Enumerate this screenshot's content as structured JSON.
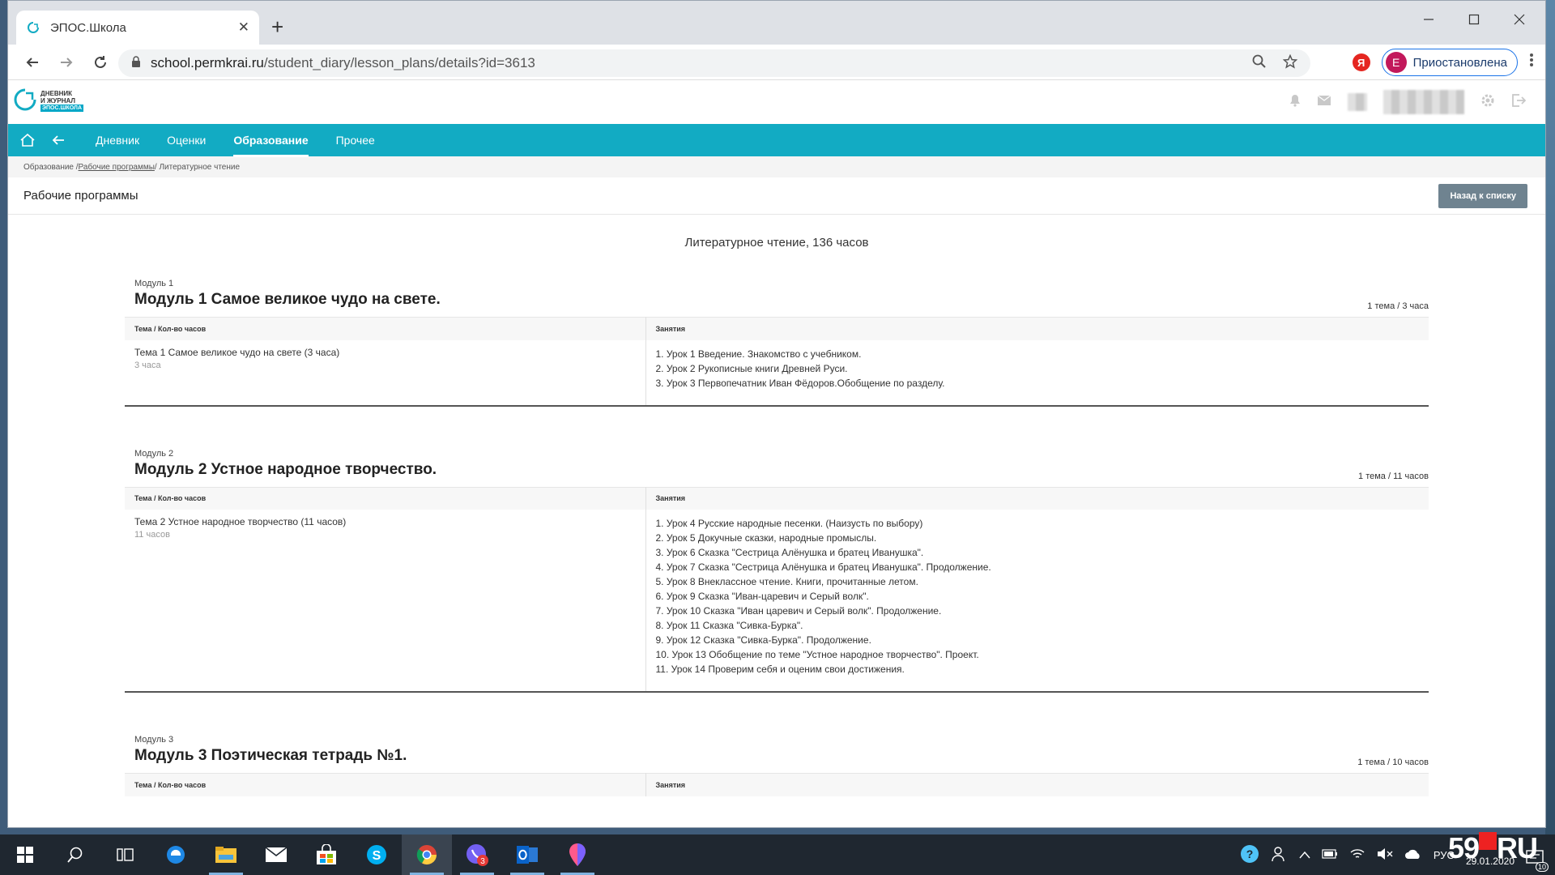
{
  "browser": {
    "tab_title": "ЭПОС.Школа",
    "tab_close": "✕",
    "new_tab": "+",
    "url_host": "school.permkrai.ru",
    "url_path": "/student_diary/lesson_plans/details?id=3613",
    "yandex_label": "Я",
    "profile_initial": "E",
    "profile_label": "Приостановлена"
  },
  "site": {
    "logo_line1": "ДНЕВНИК",
    "logo_line2": "И ЖУРНАЛ",
    "logo_line3": "ЭПОС.ШКОЛА"
  },
  "nav": {
    "items": [
      {
        "label": "Дневник"
      },
      {
        "label": "Оценки"
      },
      {
        "label": "Образование"
      },
      {
        "label": "Прочее"
      }
    ]
  },
  "breadcrumb": {
    "part1": "Образование / ",
    "part2": "Рабочие программы",
    "part3": " / Литературное чтение"
  },
  "page": {
    "title": "Рабочие программы",
    "back_button": "Назад к списку",
    "subject": "Литературное чтение, 136 часов"
  },
  "table_headers": {
    "col1": "Тема / Кол-во часов",
    "col2": "Занятия"
  },
  "modules": [
    {
      "label": "Модуль 1",
      "title": "Модуль 1 Самое великое чудо на свете.",
      "count": "1 тема / 3 часа",
      "topic": "Тема 1 Самое великое чудо на свете (3 часа)",
      "hours": "3 часа",
      "lessons": [
        "1. Урок 1 Введение. Знакомство с учебником.",
        "2. Урок 2 Рукописные книги Древней Руси.",
        "3. Урок 3 Первопечатник Иван Фёдоров.Обобщение по разделу."
      ]
    },
    {
      "label": "Модуль 2",
      "title": "Модуль 2 Устное народное творчество.",
      "count": "1 тема / 11 часов",
      "topic": "Тема 2 Устное народное творчество (11 часов)",
      "hours": "11 часов",
      "lessons": [
        "1. Урок 4 Русские народные песенки. (Наизусть по выбору)",
        "2. Урок 5 Докучные сказки, народные промыслы.",
        "3. Урок 6 Сказка \"Сестрица Алёнушка и братец Иванушка\".",
        "4. Урок 7 Сказка \"Сестрица Алёнушка и братец Иванушка\". Продолжение.",
        "5. Урок 8 Внеклассное чтение. Книги, прочитанные летом.",
        "6. Урок 9 Сказка \"Иван-царевич и Серый волк\".",
        "7. Урок 10 Сказка \"Иван царевич и Серый волк\". Продолжение.",
        "8. Урок 11 Сказка \"Сивка-Бурка\".",
        "9. Урок 12 Сказка \"Сивка-Бурка\". Продолжение.",
        "10. Урок 13 Обобщение по теме \"Устное народное творчество\". Проект.",
        "11. Урок 14 Проверим себя и оценим свои достижения."
      ]
    },
    {
      "label": "Модуль 3",
      "title": "Модуль 3 Поэтическая тетрадь №1.",
      "count": "1 тема / 10 часов"
    }
  ],
  "taskbar": {
    "viber_badge": "3",
    "lang": "РУС",
    "time": "",
    "date": "29.01.2020",
    "notif_count": "10",
    "watermark_num": "59",
    "watermark_ru": "RU"
  },
  "icons": [
    "refresh-icon",
    "back-arrow-icon",
    "forward-arrow-icon",
    "lock-icon",
    "zoom-icon",
    "star-icon",
    "bell-icon",
    "mail-icon",
    "settings-icon",
    "logout-icon",
    "home-icon"
  ]
}
